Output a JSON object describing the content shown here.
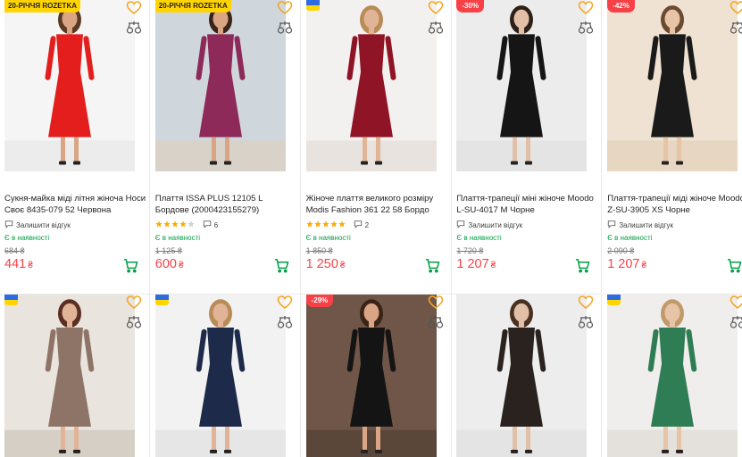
{
  "currency": "₴",
  "labels": {
    "in_stock": "Є в наявності",
    "leave_review": "Залишити відгук"
  },
  "colors": {
    "price": "#f84147",
    "stock": "#00a046",
    "cart": "#00a046",
    "promo_badge": "#ffd400",
    "discount_badge": "#f84147"
  },
  "icons": [
    "heart-icon",
    "compare-scales-icon",
    "cart-icon",
    "review-bubble-icon",
    "ukraine-flag-icon",
    "star-icon"
  ],
  "products": [
    {
      "badge": "20-РІЧЧЯ ROZETKA",
      "badge_type": "promo",
      "title": "Сукня-майка міді літня жіноча Носи Своє 8435-079 52 Червона",
      "rating": null,
      "reviews": null,
      "old_price": "684 ₴",
      "price": "441",
      "photo": {
        "bg": "#f5f5f5",
        "dress": "#e41d1d",
        "skin": "#d9a585",
        "hair": "#5a3a24",
        "floor": "#ececec"
      }
    },
    {
      "badge": "20-РІЧЧЯ ROZETKA",
      "badge_type": "promo",
      "title": "Плаття ISSA PLUS 12105 L Бордове (2000423155279)",
      "rating": 4,
      "reviews": "6",
      "old_price": "1 125 ₴",
      "price": "600",
      "photo": {
        "bg": "#cfd6dc",
        "dress": "#8d2a5a",
        "skin": "#d9a585",
        "hair": "#3a2418",
        "floor": "#d8d2c8"
      }
    },
    {
      "badge": "",
      "badge_type": "flag",
      "title": "Жіноче плаття великого розміру Modis Fashion 361 22 58 Бордо",
      "rating": 5,
      "reviews": "2",
      "old_price": "1 850 ₴",
      "price": "1 250",
      "photo": {
        "bg": "#f3f1ef",
        "dress": "#8f1426",
        "skin": "#e2b497",
        "hair": "#b98b56",
        "floor": "#e8e3de"
      }
    },
    {
      "badge": "-30%",
      "badge_type": "discount",
      "title": "Плаття-трапеції міні жіноче Moodo L-SU-4017 M Чорне",
      "rating": null,
      "reviews": null,
      "old_price": "1 720 ₴",
      "price": "1 207",
      "photo": {
        "bg": "#ececec",
        "dress": "#151515",
        "skin": "#e2c0a8",
        "hair": "#2e2018",
        "floor": "#e4e4e4"
      }
    },
    {
      "badge": "-42%",
      "badge_type": "discount",
      "title": "Плаття-трапеції міді жіноче Moodo Z-SU-3905 XS Чорне",
      "rating": null,
      "reviews": null,
      "old_price": "2 090 ₴",
      "price": "1 207",
      "photo": {
        "bg": "#efe2d2",
        "dress": "#1a1a1a",
        "skin": "#e8c4a6",
        "hair": "#6b4a30",
        "floor": "#e6d6c2"
      }
    },
    {
      "badge": "",
      "badge_type": "flag",
      "photo": {
        "bg": "#e9e4dd",
        "dress": "#8e7466",
        "skin": "#e2b497",
        "hair": "#5a2e20",
        "floor": "#d6cfc6"
      }
    },
    {
      "badge": "",
      "badge_type": "flag",
      "photo": {
        "bg": "#f2f2f2",
        "dress": "#1e2a4a",
        "skin": "#e2b497",
        "hair": "#b98b56",
        "floor": "#e6e6e6"
      }
    },
    {
      "badge": "-29%",
      "badge_type": "discount",
      "photo": {
        "bg": "#6f5648",
        "dress": "#141414",
        "skin": "#d9a585",
        "hair": "#3a2418",
        "floor": "#5b463a"
      }
    },
    {
      "badge": "",
      "badge_type": "none",
      "photo": {
        "bg": "#ededed",
        "dress": "#2a221e",
        "skin": "#e2c0a8",
        "hair": "#4a3020",
        "floor": "#e4e4e4"
      }
    },
    {
      "badge": "",
      "badge_type": "flag",
      "photo": {
        "bg": "#f0eeec",
        "dress": "#2e7d55",
        "skin": "#e8c4a6",
        "hair": "#c19a6b",
        "floor": "#e4e0dc"
      }
    }
  ]
}
